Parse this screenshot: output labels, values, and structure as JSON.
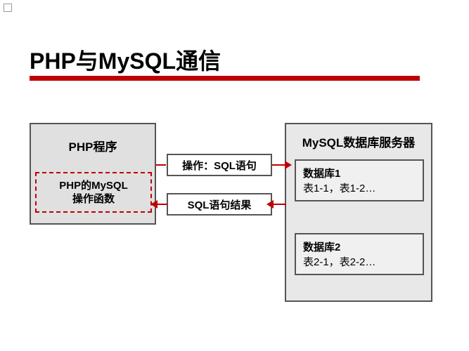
{
  "title": "PHP与MySQL通信",
  "phpBox": {
    "title": "PHP程序",
    "innerLine1": "PHP的MySQL",
    "innerLine2": "操作函数"
  },
  "mysqlBox": {
    "title": "MySQL数据库服务器",
    "db1": {
      "title": "数据库1",
      "tables": "表1-1，表1-2…"
    },
    "db2": {
      "title": "数据库2",
      "tables": "表2-1，表2-2…"
    }
  },
  "operations": {
    "toMysql": "操作：SQL语句",
    "fromMysql": "SQL语句结果"
  }
}
